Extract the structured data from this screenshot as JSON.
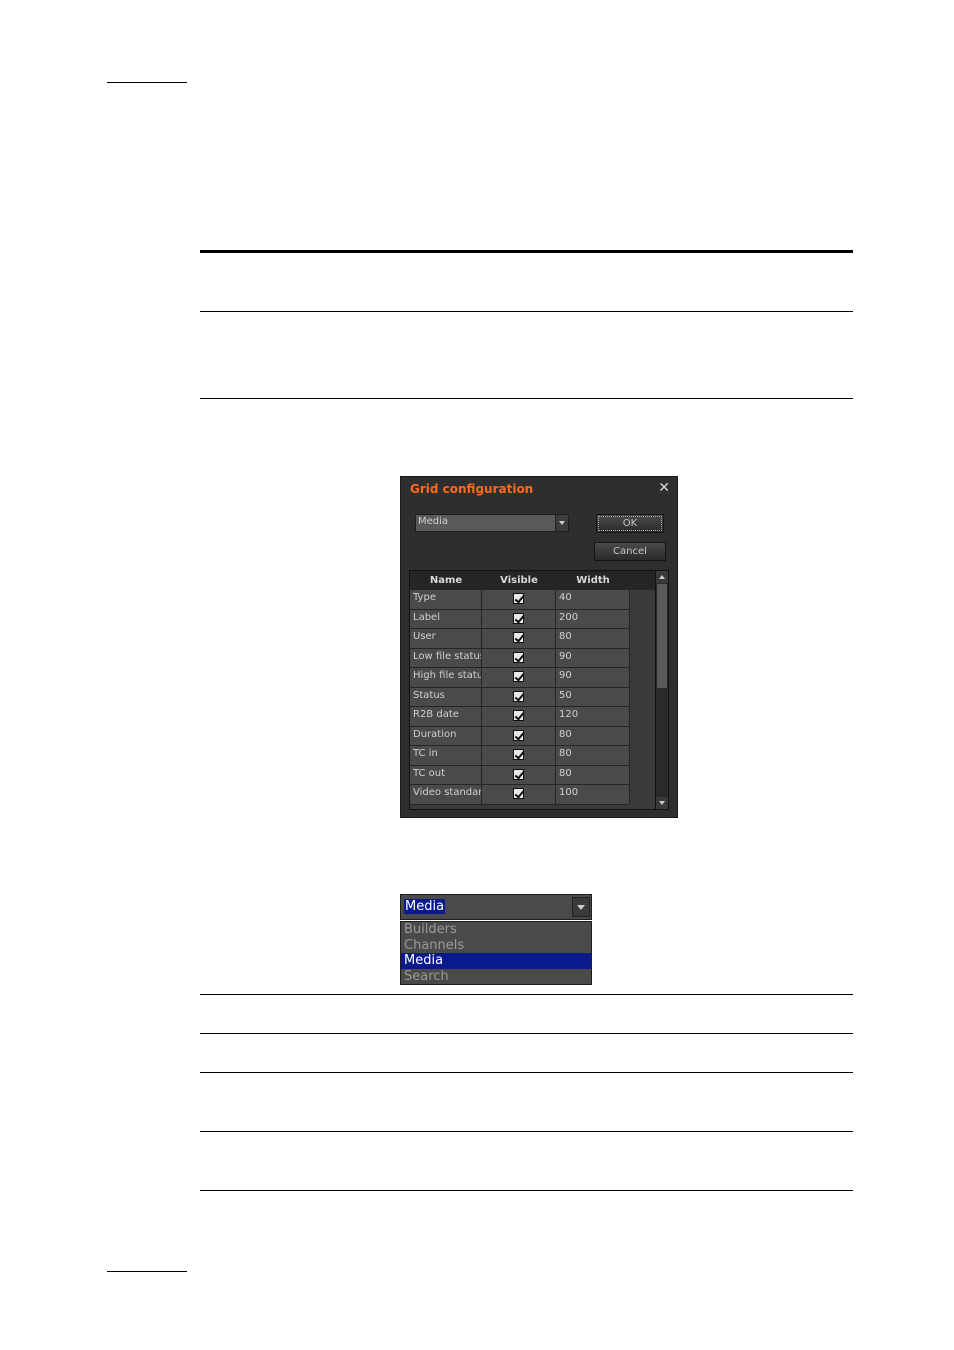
{
  "dialog": {
    "title": "Grid configuration",
    "close_glyph": "✕",
    "profile_select_value": "Media",
    "ok_label": "OK",
    "cancel_label": "Cancel",
    "columns": [
      "Name",
      "Visible",
      "Width"
    ],
    "rows": [
      {
        "name": "Type",
        "visible": true,
        "width": "40"
      },
      {
        "name": "Label",
        "visible": true,
        "width": "200"
      },
      {
        "name": "User",
        "visible": true,
        "width": "80"
      },
      {
        "name": "Low file status",
        "visible": true,
        "width": "90"
      },
      {
        "name": "High file status",
        "visible": true,
        "width": "90"
      },
      {
        "name": "Status",
        "visible": true,
        "width": "50"
      },
      {
        "name": "R2B date",
        "visible": true,
        "width": "120"
      },
      {
        "name": "Duration",
        "visible": true,
        "width": "80"
      },
      {
        "name": "TC in",
        "visible": true,
        "width": "80"
      },
      {
        "name": "TC out",
        "visible": true,
        "width": "80"
      },
      {
        "name": "Video standard",
        "visible": true,
        "width": "100"
      }
    ],
    "colors": {
      "title": "#ff6a1a",
      "background": "#2e2e2e"
    }
  },
  "dropdown": {
    "value": "Media",
    "options": [
      "Builders",
      "Channels",
      "Media",
      "Search"
    ],
    "selected_index": 2,
    "colors": {
      "highlight": "#0a1a8c"
    }
  }
}
